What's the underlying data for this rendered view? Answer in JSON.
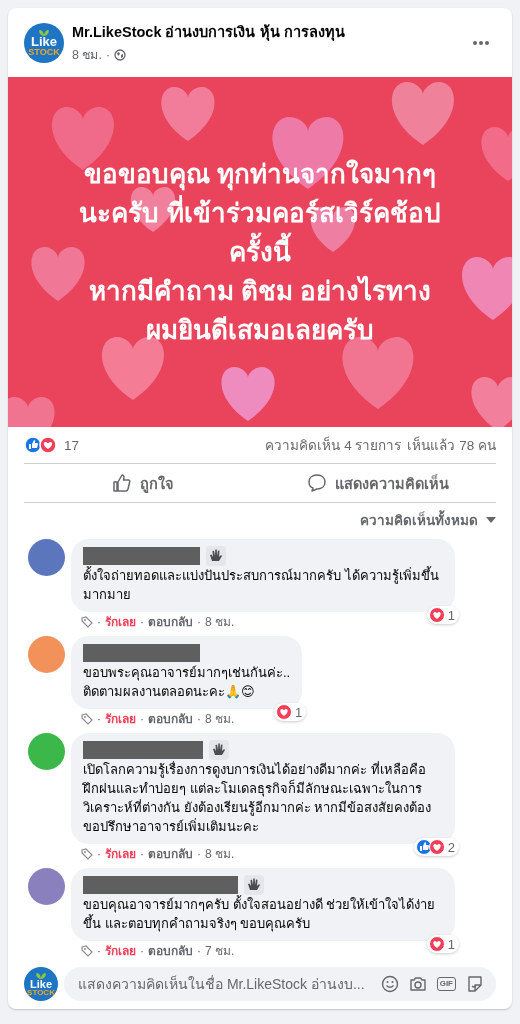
{
  "post": {
    "page_name": "Mr.LikeStock อ่านงบการเงิน หุ้น การลงทุน",
    "time": "8 ชม.",
    "separator": "·",
    "logo": {
      "top": "Like",
      "bottom": "STOCK"
    },
    "message_lines": [
      "ขอขอบคุณ ทุกท่านจากใจมากๆ",
      "นะครับ ที่เข้าร่วมคอร์สเวิร์คช้อป",
      "ครั้งนี้",
      "หากมีคำถาม ติชม อย่างไรทาง",
      "ผมยินดีเสมอเลยครับ"
    ]
  },
  "stats": {
    "reaction_count": "17",
    "comments": "ความคิดเห็น 4 รายการ",
    "views": "เห็นแล้ว 78 คน"
  },
  "actions": [
    {
      "kind": "like",
      "label": "ถูกใจ"
    },
    {
      "kind": "comment",
      "label": "แสดงความคิดเห็น"
    }
  ],
  "sort": {
    "label": "ความคิดเห็นทั้งหมด"
  },
  "comments": [
    {
      "color": "#5b76bd",
      "wave": true,
      "text": "ตั้งใจถ่ายทอดและแบ่งปันประสบการณ์มากครับ ได้ความรู้เพิ่มขึ้นมากมาย",
      "reactions": [
        {
          "kind": "heart"
        }
      ],
      "reaction_count": "1",
      "loved": true,
      "love_label": "รักเลย",
      "reply_label": "ตอบกลับ",
      "time": "8 ชม.",
      "separators": [
        "·",
        "·",
        "·"
      ]
    },
    {
      "color": "#f3915a",
      "wave": false,
      "text": "ขอบพระคุณอาจารย์มากๆเช่นกันค่ะ..\nติดตามผลงานตลอดนะคะ🙏😊",
      "reactions": [
        {
          "kind": "heart"
        }
      ],
      "reaction_count": "1",
      "loved": true,
      "love_label": "รักเลย",
      "reply_label": "ตอบกลับ",
      "time": "8 ชม.",
      "separators": [
        "·",
        "·",
        "·"
      ]
    },
    {
      "color": "#3cb84a",
      "wave": true,
      "text": "เปิดโลกความรู้เรื่องการดูงบการเงินได้อย่างดีมากค่ะ ที่เหลือคือฝึกฝนและทำบ่อยๆ แต่ละโมเดลธุรกิจก็มีลักษณะเฉพาะในการวิเคราะห์ที่ต่างกัน ยังต้องเรียนรู้อีกมากค่ะ หากมีข้อสงสัยคงต้องขอปรึกษาอาจารย์เพิ่มเติมนะคะ",
      "reactions": [
        {
          "kind": "like"
        },
        {
          "kind": "heart"
        }
      ],
      "reaction_count": "2",
      "loved": true,
      "love_label": "รักเลย",
      "reply_label": "ตอบกลับ",
      "time": "8 ชม.",
      "separators": [
        "·",
        "·",
        "·"
      ]
    },
    {
      "color": "#8b80be",
      "wave": true,
      "text": "ขอบคุณอาจารย์มากๆครับ ตั้งใจสอนอย่างดี ช่วยให้เข้าใจได้ง่ายขึ้น และตอบทุกคำถามจริงๆ ขอบคุณครับ",
      "reactions": [
        {
          "kind": "heart"
        }
      ],
      "reaction_count": "1",
      "loved": true,
      "love_label": "รักเลย",
      "reply_label": "ตอบกลับ",
      "time": "7 ชม.",
      "separators": [
        "·",
        "·",
        "·"
      ]
    }
  ],
  "composer": {
    "logo": {
      "top": "Like",
      "bottom": "STOCK"
    },
    "placeholder": "แสดงความคิดเห็นในชื่อ Mr.LikeStock อ่านงบ...",
    "gif_label": "GIF"
  }
}
